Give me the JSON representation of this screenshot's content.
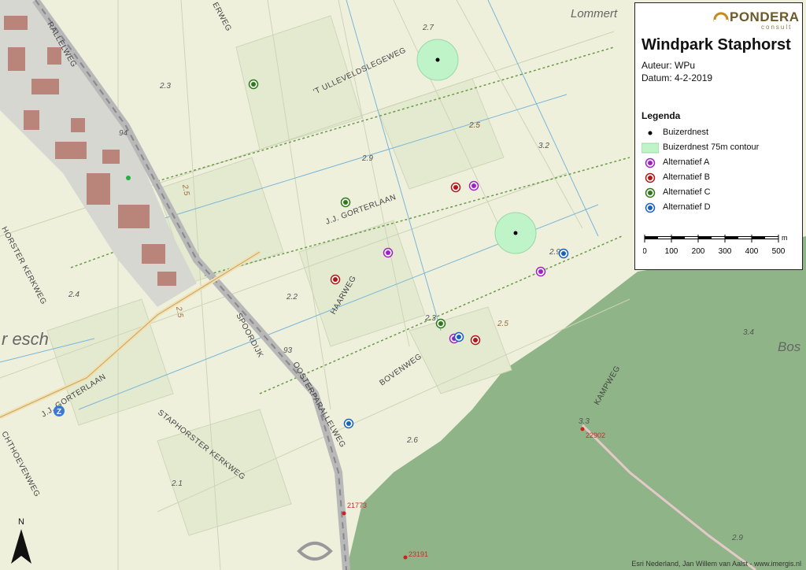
{
  "map": {
    "place_labels": [
      "Lommert",
      "r esch",
      "Bos"
    ],
    "road_labels": [
      "'T ULLEVELDSLEGEWEG",
      "J.J. GORTERLAAN",
      "HAARWEG",
      "BOVENWEG",
      "SPOORDIJK",
      "OOSTERPARALLELWEG",
      "STAPHORSTER KERKWEG",
      "KAMPWEG",
      "J.J. GORTERLAAN",
      "RALLELWEG",
      "HORSTER KERKWEG",
      "CHTHOEVENWEG",
      "ERWEG"
    ],
    "elevation_labels": [
      "2.7",
      "2.3",
      "2.9",
      "3.2",
      "2.5",
      "2.2",
      "2.4",
      "2.3",
      "2.9",
      "2.6",
      "2.1",
      "3.4",
      "3.3",
      "2.9"
    ],
    "contour_labels": [
      "2.5",
      "2.5",
      "2.5",
      "2.5"
    ],
    "railway_km": [
      "94",
      "93"
    ],
    "road_markers": [
      "21773",
      "22902",
      "23191"
    ],
    "marker_icon": "parking-icon",
    "credit": "Esri Nederland, Jan Willem van Aalst - www.imergis.nl"
  },
  "colors": {
    "buizerdnest": "#000000",
    "contour75": "#bff3c8",
    "alternatief_a": "#a020c8",
    "alternatief_b": "#b01818",
    "alternatief_c": "#2e7a18",
    "alternatief_d": "#1860c0",
    "forest": "#8fb487",
    "land": "#eef0dc",
    "water_line": "#7ab6d8",
    "road": "#c9c9c9"
  },
  "legend": {
    "logo": "PONDERA",
    "logo_sub": "consult",
    "title": "Windpark Staphorst",
    "author": "Auteur: WPu",
    "date": "Datum: 4-2-2019",
    "heading": "Legenda",
    "items": [
      {
        "label": "Buizerdnest",
        "symbol": "nest-point-icon"
      },
      {
        "label": "Buizerdnest 75m contour",
        "symbol": "contour-patch-icon"
      },
      {
        "label": "Alternatief A",
        "symbol": "turbine-a-icon"
      },
      {
        "label": "Alternatief B",
        "symbol": "turbine-b-icon"
      },
      {
        "label": "Alternatief C",
        "symbol": "turbine-c-icon"
      },
      {
        "label": "Alternatief D",
        "symbol": "turbine-d-icon"
      }
    ],
    "scale": {
      "unit": "m",
      "ticks": [
        "0",
        "100",
        "200",
        "300",
        "400",
        "500"
      ]
    }
  },
  "north_label": "N"
}
